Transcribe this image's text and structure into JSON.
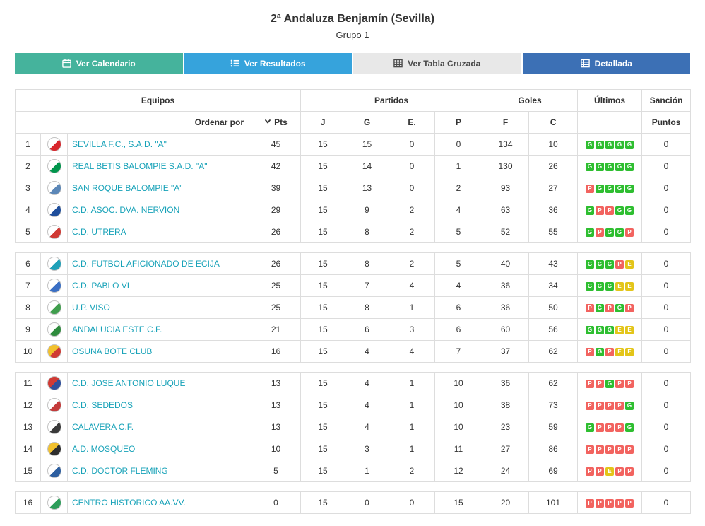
{
  "page": {
    "title": "2ª Andaluza Benjamín (Sevilla)",
    "subtitle": "Grupo 1"
  },
  "tabs": [
    {
      "label": "Ver Calendario",
      "icon": "calendar-icon",
      "bg": "#45b39c",
      "fg": "#ffffff"
    },
    {
      "label": "Ver Resultados",
      "icon": "list-icon",
      "bg": "#36a3dc",
      "fg": "#ffffff"
    },
    {
      "label": "Ver Tabla Cruzada",
      "icon": "table-icon",
      "bg": "#e8e8e8",
      "fg": "#4a4a4a"
    },
    {
      "label": "Detallada",
      "icon": "detail-icon",
      "bg": "#3c70b5",
      "fg": "#ffffff"
    }
  ],
  "table": {
    "team_link_color": "#17a2b8",
    "group_headers": {
      "teams": "Equipos",
      "matches": "Partidos",
      "goals": "Goles",
      "last": "Últimos",
      "sanction": "Sanción"
    },
    "sub_headers": {
      "order_by": "Ordenar por",
      "pts": "Pts",
      "played": "J",
      "won": "G",
      "drawn": "E.",
      "lost": "P",
      "goals_for": "F",
      "goals_against": "C",
      "sanction_points": "Puntos"
    },
    "legend_colors": {
      "win": "#2ebe30",
      "draw": "#e3c519",
      "loss": "#f2635f"
    },
    "groups": [
      [
        {
          "pos": 1,
          "team": "SEVILLA F.C., S.A.D. \"A\"",
          "pts": 45,
          "j": 15,
          "g": 15,
          "e": 0,
          "p": 0,
          "f": 134,
          "c": 10,
          "last5": [
            "G",
            "G",
            "G",
            "G",
            "G"
          ],
          "sancion": 0,
          "crest": [
            "#ffffff",
            "#d8262c"
          ]
        },
        {
          "pos": 2,
          "team": "REAL BETIS BALOMPIE S.A.D. \"A\"",
          "pts": 42,
          "j": 15,
          "g": 14,
          "e": 0,
          "p": 1,
          "f": 130,
          "c": 26,
          "last5": [
            "G",
            "G",
            "G",
            "G",
            "G"
          ],
          "sancion": 0,
          "crest": [
            "#ffffff",
            "#00954c"
          ]
        },
        {
          "pos": 3,
          "team": "SAN ROQUE BALOMPIE \"A\"",
          "pts": 39,
          "j": 15,
          "g": 13,
          "e": 0,
          "p": 2,
          "f": 93,
          "c": 27,
          "last5": [
            "P",
            "G",
            "G",
            "G",
            "G"
          ],
          "sancion": 0,
          "crest": [
            "#ffffff",
            "#5b87b8"
          ]
        },
        {
          "pos": 4,
          "team": "C.D. ASOC. DVA. NERVION",
          "pts": 29,
          "j": 15,
          "g": 9,
          "e": 2,
          "p": 4,
          "f": 63,
          "c": 36,
          "last5": [
            "G",
            "P",
            "P",
            "G",
            "G"
          ],
          "sancion": 0,
          "crest": [
            "#ffffff",
            "#1f4e9c"
          ]
        },
        {
          "pos": 5,
          "team": "C.D. UTRERA",
          "pts": 26,
          "j": 15,
          "g": 8,
          "e": 2,
          "p": 5,
          "f": 52,
          "c": 55,
          "last5": [
            "G",
            "P",
            "G",
            "G",
            "P"
          ],
          "sancion": 0,
          "crest": [
            "#ffffff",
            "#d03a34"
          ]
        }
      ],
      [
        {
          "pos": 6,
          "team": "C.D. FUTBOL AFICIONADO DE ECIJA",
          "pts": 26,
          "j": 15,
          "g": 8,
          "e": 2,
          "p": 5,
          "f": 40,
          "c": 43,
          "last5": [
            "G",
            "G",
            "G",
            "P",
            "E"
          ],
          "sancion": 0,
          "crest": [
            "#ffffff",
            "#1fa0b8"
          ]
        },
        {
          "pos": 7,
          "team": "C.D. PABLO VI",
          "pts": 25,
          "j": 15,
          "g": 7,
          "e": 4,
          "p": 4,
          "f": 36,
          "c": 34,
          "last5": [
            "G",
            "G",
            "G",
            "E",
            "E"
          ],
          "sancion": 0,
          "crest": [
            "#ffffff",
            "#3a6fc4"
          ]
        },
        {
          "pos": 8,
          "team": "U.P. VISO",
          "pts": 25,
          "j": 15,
          "g": 8,
          "e": 1,
          "p": 6,
          "f": 36,
          "c": 50,
          "last5": [
            "P",
            "G",
            "P",
            "G",
            "P"
          ],
          "sancion": 0,
          "crest": [
            "#ffffff",
            "#3f9e4d"
          ]
        },
        {
          "pos": 9,
          "team": "ANDALUCIA ESTE C.F.",
          "pts": 21,
          "j": 15,
          "g": 6,
          "e": 3,
          "p": 6,
          "f": 60,
          "c": 56,
          "last5": [
            "G",
            "G",
            "G",
            "E",
            "E"
          ],
          "sancion": 0,
          "crest": [
            "#ffffff",
            "#2e8b3d"
          ]
        },
        {
          "pos": 10,
          "team": "OSUNA BOTE CLUB",
          "pts": 16,
          "j": 15,
          "g": 4,
          "e": 4,
          "p": 7,
          "f": 37,
          "c": 62,
          "last5": [
            "P",
            "G",
            "P",
            "E",
            "E"
          ],
          "sancion": 0,
          "crest": [
            "#f2c12e",
            "#d03a34"
          ]
        }
      ],
      [
        {
          "pos": 11,
          "team": "C.D. JOSE ANTONIO LUQUE",
          "pts": 13,
          "j": 15,
          "g": 4,
          "e": 1,
          "p": 10,
          "f": 36,
          "c": 62,
          "last5": [
            "P",
            "P",
            "G",
            "P",
            "P"
          ],
          "sancion": 0,
          "crest": [
            "#d03a34",
            "#2e4f9c"
          ]
        },
        {
          "pos": 12,
          "team": "C.D. SEDEDOS",
          "pts": 13,
          "j": 15,
          "g": 4,
          "e": 1,
          "p": 10,
          "f": 38,
          "c": 73,
          "last5": [
            "P",
            "P",
            "P",
            "P",
            "G"
          ],
          "sancion": 0,
          "crest": [
            "#ffffff",
            "#c43a3a"
          ]
        },
        {
          "pos": 13,
          "team": "CALAVERA C.F.",
          "pts": 13,
          "j": 15,
          "g": 4,
          "e": 1,
          "p": 10,
          "f": 23,
          "c": 59,
          "last5": [
            "G",
            "P",
            "P",
            "P",
            "G"
          ],
          "sancion": 0,
          "crest": [
            "#ffffff",
            "#3a3a3a"
          ]
        },
        {
          "pos": 14,
          "team": "A.D. MOSQUEO",
          "pts": 10,
          "j": 15,
          "g": 3,
          "e": 1,
          "p": 11,
          "f": 27,
          "c": 86,
          "last5": [
            "P",
            "P",
            "P",
            "P",
            "P"
          ],
          "sancion": 0,
          "crest": [
            "#f2c12e",
            "#2e2e2e"
          ]
        },
        {
          "pos": 15,
          "team": "C.D. DOCTOR FLEMING",
          "pts": 5,
          "j": 15,
          "g": 1,
          "e": 2,
          "p": 12,
          "f": 24,
          "c": 69,
          "last5": [
            "P",
            "P",
            "E",
            "P",
            "P"
          ],
          "sancion": 0,
          "crest": [
            "#ffffff",
            "#2e5fa0"
          ]
        }
      ],
      [
        {
          "pos": 16,
          "team": "CENTRO HISTORICO AA.VV.",
          "pts": 0,
          "j": 15,
          "g": 0,
          "e": 0,
          "p": 15,
          "f": 20,
          "c": 101,
          "last5": [
            "P",
            "P",
            "P",
            "P",
            "P"
          ],
          "sancion": 0,
          "crest": [
            "#ffffff",
            "#2e9e5b"
          ]
        }
      ]
    ]
  }
}
